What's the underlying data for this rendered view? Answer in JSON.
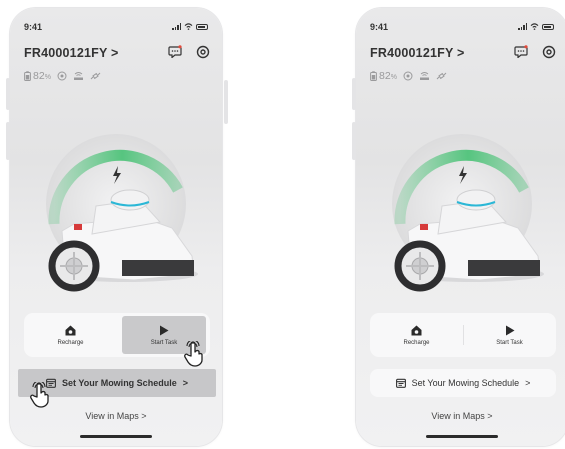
{
  "status_bar": {
    "time": "9:41"
  },
  "device": {
    "name": "FR4000121FY >",
    "battery_percent": "82",
    "battery_unit": "%"
  },
  "actions": {
    "recharge_label": "Recharge",
    "start_task_label": "Start Task"
  },
  "schedule": {
    "label": "Set Your Mowing Schedule",
    "chevron": ">"
  },
  "maps": {
    "label": "View in Maps",
    "chevron": ">"
  },
  "colors": {
    "arc_green": "#4fc37a",
    "robot_accent": "#2bb7d6",
    "robot_red": "#d63a3a",
    "notification_red": "#e24a3b",
    "pressed_gray": "#c8c8ca"
  },
  "icons": {
    "message": "message-icon",
    "settings": "settings-icon",
    "battery": "battery-icon",
    "wifi": "wifi-icon",
    "rtk": "rtk-icon",
    "satellite": "satellite-icon",
    "home": "home-icon",
    "play": "play-icon",
    "calendar": "calendar-icon",
    "lightning": "lightning-icon",
    "hand": "tap-hand-icon"
  }
}
